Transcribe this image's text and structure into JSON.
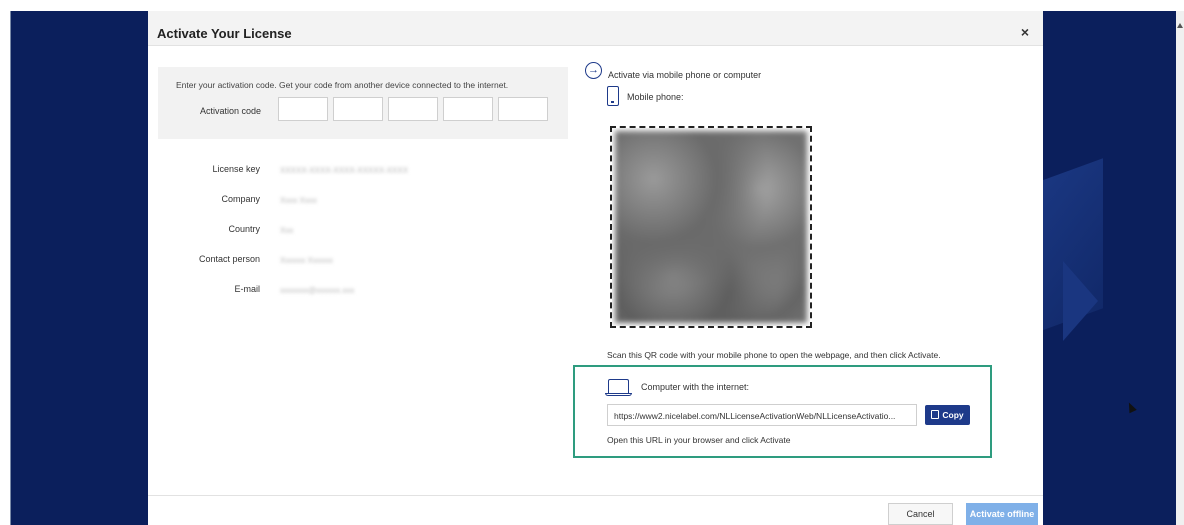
{
  "dialog": {
    "title": "Activate Your License",
    "close_symbol": "×"
  },
  "code_panel": {
    "instruction": "Enter your activation code. Get your code from another device connected to the internet.",
    "label": "Activation code"
  },
  "license_info": [
    {
      "label": "License key",
      "value": "XXXXX-XXXX-XXXX-XXXXX-XXXX"
    },
    {
      "label": "Company",
      "value": "Xxxx Xxxx"
    },
    {
      "label": "Country",
      "value": "Xxx"
    },
    {
      "label": "Contact person",
      "value": "Xxxxxx Xxxxxx"
    },
    {
      "label": "E-mail",
      "value": "xxxxxxx@xxxxxx.xxx"
    }
  ],
  "mobile": {
    "via_text": "Activate via mobile phone or computer",
    "phone_label": "Mobile phone:",
    "scan_text": "Scan this QR code with your mobile phone to open the webpage, and then click Activate."
  },
  "internet": {
    "label": "Computer with the internet:",
    "url": "https://www2.nicelabel.com/NLLicenseActivationWeb/NLLicenseActivatio...",
    "copy_label": "Copy",
    "open_text": "Open this URL in your browser and click Activate"
  },
  "footer": {
    "cancel_label": "Cancel",
    "activate_label": "Activate offline"
  },
  "colors": {
    "brand_navy": "#0b1f5c",
    "primary_button": "#1e3a8a",
    "highlight_border": "#2e9c7f",
    "disabled_button": "#7fb0e8"
  }
}
